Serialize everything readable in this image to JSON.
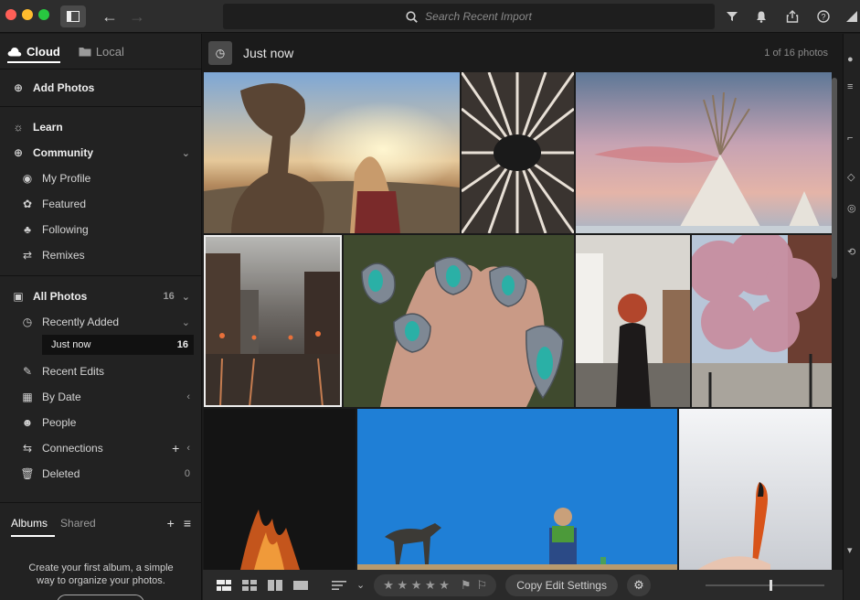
{
  "titlebar": {
    "search_placeholder": "Search Recent Import"
  },
  "sidebar": {
    "source_tabs": [
      {
        "label": "Cloud",
        "active": true
      },
      {
        "label": "Local",
        "active": false
      }
    ],
    "add_photos": "Add Photos",
    "learn": "Learn",
    "community": "Community",
    "community_items": [
      "My Profile",
      "Featured",
      "Following",
      "Remixes"
    ],
    "all_photos": {
      "label": "All Photos",
      "count": "16"
    },
    "recently_added": "Recently Added",
    "just_now": {
      "label": "Just now",
      "count": "16"
    },
    "recent_edits": "Recent Edits",
    "by_date": "By Date",
    "people": "People",
    "connections": "Connections",
    "deleted": {
      "label": "Deleted",
      "count": "0"
    },
    "albums": {
      "tabs": [
        {
          "label": "Albums",
          "active": true
        },
        {
          "label": "Shared",
          "active": false
        }
      ],
      "empty_text": "Create your first album, a simple way to organize your photos."
    }
  },
  "main": {
    "title": "Just now",
    "count_text": "1 of 16 photos",
    "photos": [
      {
        "name": "balanced-rock",
        "selected": false
      },
      {
        "name": "radial-light-ceiling",
        "selected": false
      },
      {
        "name": "teepee-sunset",
        "selected": false
      },
      {
        "name": "rainy-city-street",
        "selected": true
      },
      {
        "name": "turquoise-rings",
        "selected": false
      },
      {
        "name": "woman-red-hair",
        "selected": false
      },
      {
        "name": "cherry-blossom-street",
        "selected": false
      },
      {
        "name": "campfire-night",
        "selected": false
      },
      {
        "name": "dog-and-reader-blue-sky",
        "selected": false
      },
      {
        "name": "orange-feather",
        "selected": false
      }
    ]
  },
  "bottombar": {
    "copy_edit_settings": "Copy Edit Settings",
    "stars": "★ ★ ★ ★ ★"
  },
  "colors": {
    "background": "#1b1b1b",
    "sidebar": "#222222",
    "titlebar": "#2d2d2d",
    "accent_white": "#ffffff"
  }
}
